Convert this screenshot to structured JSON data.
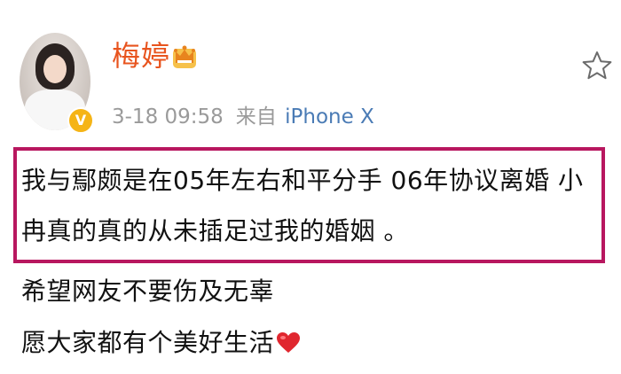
{
  "post": {
    "author": {
      "name": "梅婷",
      "avatar_icon": "avatar-photo",
      "badge_icon": "verified-v-icon",
      "badge_text": "V",
      "badge_color": "#f5b416",
      "crown_icon": "crown-icon",
      "name_color": "#e8541e"
    },
    "meta": {
      "time": "3-18 09:58",
      "source_prefix": "来自",
      "device": "iPhone X"
    },
    "actions": {
      "favorite_icon": "star-icon"
    },
    "text": {
      "line1": "我与鄢颇是在05年左右和平分手  06年协议离婚  小",
      "line2": "冉真的真的从未插足过我的婚姻 。",
      "line3": "希望网友不要伤及无辜",
      "line4": "愿大家都有个美好生活",
      "line4_emoji": "heart-icon"
    },
    "highlight": {
      "color": "#b8175f"
    }
  }
}
